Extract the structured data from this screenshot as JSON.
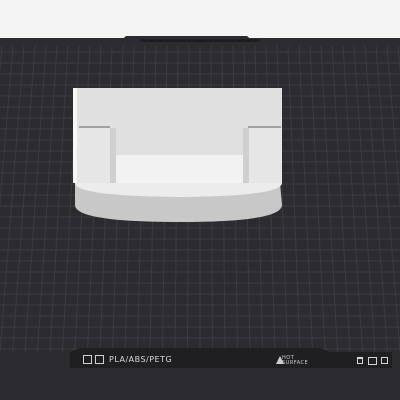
{
  "bed_plate": {
    "filament_label": "PLA/ABS/PETG",
    "warning_label_line1": "HOT",
    "warning_label_line2": "SURFACE"
  },
  "colors": {
    "background": "#2c2c30",
    "grid_line": "#3b3b40",
    "bed_edge": "#4a4a4f",
    "model_light": "#e2e2e2",
    "model_shadow": "#bcbcbc",
    "sky": "#f4f4f4"
  },
  "icons": [
    "bed-logo-icon",
    "grid-icon",
    "warning-icon",
    "trash-icon",
    "frame-icon",
    "stop-icon"
  ]
}
